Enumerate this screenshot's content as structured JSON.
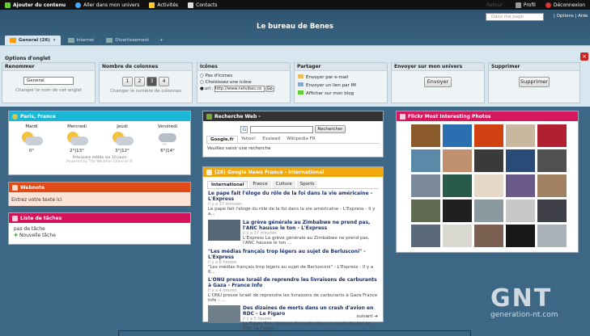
{
  "topbar": {
    "add": "Ajouter du contenu",
    "universe": "Aller dans mon univers",
    "activities": "Activités",
    "contacts": "Contacts",
    "stats": "Retour",
    "profile": "Profil",
    "logout": "Déconnexion"
  },
  "header": {
    "search_placeholder": "Dans ma page",
    "options": "| Options | Aide",
    "title": "Le bureau de Benes"
  },
  "tabs": [
    {
      "label": "General (26)"
    },
    {
      "label": "Internet"
    },
    {
      "label": "Divertissement"
    },
    {
      "label": "+"
    }
  ],
  "options_panel": {
    "heading": "Options d'onglet",
    "close": "×",
    "rename": {
      "title": "Renommer",
      "value": "General",
      "hint": "Changer le nom de cet onglet"
    },
    "columns": {
      "title": "Nombre de colonnes",
      "values": [
        "1",
        "2",
        "3",
        "4"
      ],
      "hint": "Changer le nombre de colonnes"
    },
    "icons": {
      "title": "Icônes",
      "opt1": "Pas d'icones",
      "opt2": "Choisissez une icône",
      "opt3": "url :",
      "url_value": "http://www.netvibes.co",
      "go": "Go"
    },
    "share": {
      "title": "Partager",
      "email": "Envoyer par e-mail",
      "im": "Envoyer un lien par IM",
      "blog": "Afficher sur mon blog"
    },
    "send": {
      "title": "Envoyer sur mon univers",
      "button": "Envoyer"
    },
    "delete": {
      "title": "Supprimer",
      "button": "Supprimer"
    }
  },
  "weather": {
    "title": "Paris, France",
    "days": [
      {
        "name": "Mardi",
        "temp": "0°"
      },
      {
        "name": "Mercredi",
        "temp": "2°|13°"
      },
      {
        "name": "Jeudi",
        "temp": "3°|12°"
      },
      {
        "name": "Vendredi",
        "temp": "6°|14°"
      }
    ],
    "note": "Prévisions météo sur 10 jours",
    "credit": "Powered by The Weather Channel ®"
  },
  "webnote": {
    "title": "Webnote",
    "text": "Entrez votre texte ici"
  },
  "tasks": {
    "title": "Liste de tâches",
    "empty": "pas de tâche",
    "add": "Nouvelle tâche"
  },
  "websearch": {
    "title": "Recherche Web -",
    "button": "Rechercher",
    "engines": [
      "Google.fr",
      "Yahoo!",
      "Exalead",
      "Wikipedia FR"
    ],
    "hint": "Veuillez saisir une recherche"
  },
  "gnews": {
    "title": "(28) Google News France - International",
    "tabs": [
      "International",
      "France",
      "Culture",
      "Sports"
    ],
    "items": [
      {
        "title": "Le pape fait l'éloge du rôle de la foi dans la vie américaine - L'Express",
        "meta": "Il y a 37 minutes",
        "desc": "Le pape fait l'éloge du rôle de la foi dans la vie américaine - L'Express - Il y a..."
      },
      {
        "title": "La grève générale au Zimbabwe ne prend pas, l'ANC hausse le ton - L'Express",
        "meta": "Il y a 37 minutes",
        "desc": "L'Express La grève générale au Zimbabwe ne prend pas, l'ANC hausse le ton ..."
      },
      {
        "title": "\"Les médias français trop légers au sujet de Berlusconi\" - L'Express",
        "meta": "Il y a 6 heures",
        "desc": "\"Les médias français trop légers au sujet de Berlusconi\" - L'Express - Il y a 6..."
      },
      {
        "title": "L'ONU presse Israël de reprendre les livraisons de carburants à Gaza - France Info",
        "meta": "Il y a 4 heures",
        "desc": "L'ONU presse Israël de reprendre les livraisons de carburants à Gaza France Info - ..."
      },
      {
        "title": "Des dizaines de morts dans un crash d'avion en RDC - Le Figaro",
        "meta": "Il y a 5 heures",
        "desc": "Le Figaro Des dizaines de morts dans un crash d'avion en RDC Le Figaro ..."
      }
    ],
    "next": "suivant"
  },
  "flickr": {
    "title": "Flickr Most Interesting Photos"
  },
  "watermark": {
    "brand": "GNT",
    "site": "generation-nt.com"
  }
}
